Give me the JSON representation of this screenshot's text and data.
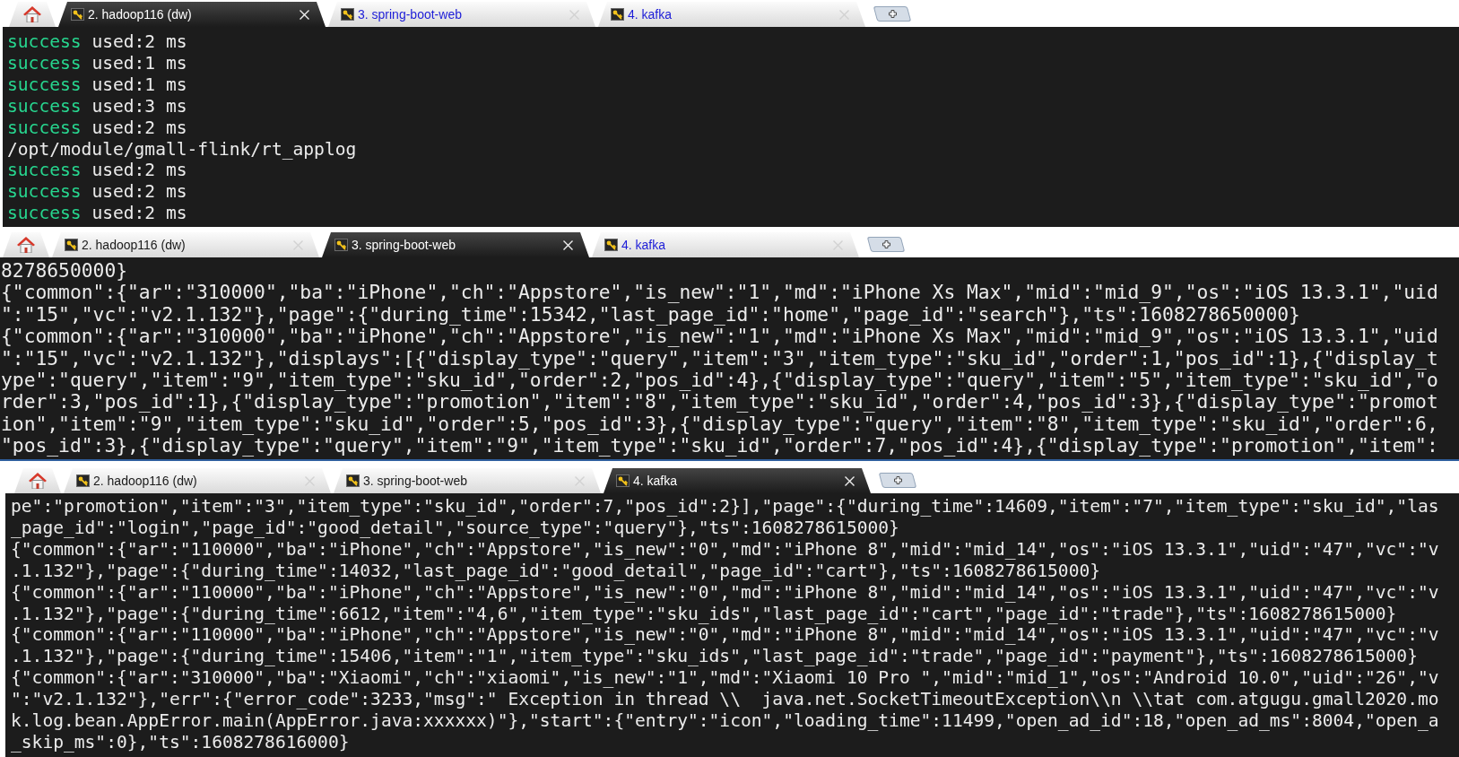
{
  "panes": [
    {
      "tabs": [
        {
          "label": "2. hadoop116 (dw)",
          "selected": true,
          "activity": false
        },
        {
          "label": "3. spring-boot-web",
          "selected": false,
          "activity": true
        },
        {
          "label": "4. kafka",
          "selected": false,
          "activity": true
        }
      ],
      "lines": [
        {
          "kind": "status",
          "status": "success",
          "text": "used:2 ms"
        },
        {
          "kind": "status",
          "status": "success",
          "text": "used:1 ms"
        },
        {
          "kind": "status",
          "status": "success",
          "text": "used:1 ms"
        },
        {
          "kind": "status",
          "status": "success",
          "text": "used:3 ms"
        },
        {
          "kind": "status",
          "status": "success",
          "text": "used:2 ms"
        },
        {
          "kind": "plain",
          "text": "/opt/module/gmall-flink/rt_applog"
        },
        {
          "kind": "status",
          "status": "success",
          "text": "used:2 ms"
        },
        {
          "kind": "status",
          "status": "success",
          "text": "used:2 ms"
        },
        {
          "kind": "status",
          "status": "success",
          "text": "used:2 ms"
        }
      ]
    },
    {
      "tabs": [
        {
          "label": "2. hadoop116 (dw)",
          "selected": false,
          "activity": false
        },
        {
          "label": "3. spring-boot-web",
          "selected": true,
          "activity": false
        },
        {
          "label": "4. kafka",
          "selected": false,
          "activity": true
        }
      ],
      "lines": [
        {
          "kind": "plain",
          "text": "8278650000}"
        },
        {
          "kind": "plain",
          "text": "{\"common\":{\"ar\":\"310000\",\"ba\":\"iPhone\",\"ch\":\"Appstore\",\"is_new\":\"1\",\"md\":\"iPhone Xs Max\",\"mid\":\"mid_9\",\"os\":\"iOS 13.3.1\",\"uid"
        },
        {
          "kind": "plain",
          "text": "\":\"15\",\"vc\":\"v2.1.132\"},\"page\":{\"during_time\":15342,\"last_page_id\":\"home\",\"page_id\":\"search\"},\"ts\":1608278650000}"
        },
        {
          "kind": "plain",
          "text": "{\"common\":{\"ar\":\"310000\",\"ba\":\"iPhone\",\"ch\":\"Appstore\",\"is_new\":\"1\",\"md\":\"iPhone Xs Max\",\"mid\":\"mid_9\",\"os\":\"iOS 13.3.1\",\"uid"
        },
        {
          "kind": "plain",
          "text": "\":\"15\",\"vc\":\"v2.1.132\"},\"displays\":[{\"display_type\":\"query\",\"item\":\"3\",\"item_type\":\"sku_id\",\"order\":1,\"pos_id\":1},{\"display_t"
        },
        {
          "kind": "plain",
          "text": "ype\":\"query\",\"item\":\"9\",\"item_type\":\"sku_id\",\"order\":2,\"pos_id\":4},{\"display_type\":\"query\",\"item\":\"5\",\"item_type\":\"sku_id\",\"o"
        },
        {
          "kind": "plain",
          "text": "rder\":3,\"pos_id\":1},{\"display_type\":\"promotion\",\"item\":\"8\",\"item_type\":\"sku_id\",\"order\":4,\"pos_id\":3},{\"display_type\":\"promot"
        },
        {
          "kind": "plain",
          "text": "ion\",\"item\":\"9\",\"item_type\":\"sku_id\",\"order\":5,\"pos_id\":3},{\"display_type\":\"query\",\"item\":\"8\",\"item_type\":\"sku_id\",\"order\":6,"
        },
        {
          "kind": "plain",
          "text": "\"pos_id\":3},{\"display_type\":\"query\",\"item\":\"9\",\"item_type\":\"sku_id\",\"order\":7,\"pos_id\":4},{\"display_type\":\"promotion\",\"item\":"
        }
      ]
    },
    {
      "tabs": [
        {
          "label": "2. hadoop116 (dw)",
          "selected": false,
          "activity": false
        },
        {
          "label": "3. spring-boot-web",
          "selected": false,
          "activity": false
        },
        {
          "label": "4. kafka",
          "selected": true,
          "activity": false
        }
      ],
      "lines": [
        {
          "kind": "plain",
          "text": "pe\":\"promotion\",\"item\":\"3\",\"item_type\":\"sku_id\",\"order\":7,\"pos_id\":2}],\"page\":{\"during_time\":14609,\"item\":\"7\",\"item_type\":\"sku_id\",\"las"
        },
        {
          "kind": "plain",
          "text": "_page_id\":\"login\",\"page_id\":\"good_detail\",\"source_type\":\"query\"},\"ts\":1608278615000}"
        },
        {
          "kind": "plain",
          "text": "{\"common\":{\"ar\":\"110000\",\"ba\":\"iPhone\",\"ch\":\"Appstore\",\"is_new\":\"0\",\"md\":\"iPhone 8\",\"mid\":\"mid_14\",\"os\":\"iOS 13.3.1\",\"uid\":\"47\",\"vc\":\"v"
        },
        {
          "kind": "plain",
          "text": ".1.132\"},\"page\":{\"during_time\":14032,\"last_page_id\":\"good_detail\",\"page_id\":\"cart\"},\"ts\":1608278615000}"
        },
        {
          "kind": "plain",
          "text": "{\"common\":{\"ar\":\"110000\",\"ba\":\"iPhone\",\"ch\":\"Appstore\",\"is_new\":\"0\",\"md\":\"iPhone 8\",\"mid\":\"mid_14\",\"os\":\"iOS 13.3.1\",\"uid\":\"47\",\"vc\":\"v"
        },
        {
          "kind": "plain",
          "text": ".1.132\"},\"page\":{\"during_time\":6612,\"item\":\"4,6\",\"item_type\":\"sku_ids\",\"last_page_id\":\"cart\",\"page_id\":\"trade\"},\"ts\":1608278615000}"
        },
        {
          "kind": "plain",
          "text": "{\"common\":{\"ar\":\"110000\",\"ba\":\"iPhone\",\"ch\":\"Appstore\",\"is_new\":\"0\",\"md\":\"iPhone 8\",\"mid\":\"mid_14\",\"os\":\"iOS 13.3.1\",\"uid\":\"47\",\"vc\":\"v"
        },
        {
          "kind": "plain",
          "text": ".1.132\"},\"page\":{\"during_time\":15406,\"item\":\"1\",\"item_type\":\"sku_ids\",\"last_page_id\":\"trade\",\"page_id\":\"payment\"},\"ts\":1608278615000}"
        },
        {
          "kind": "plain",
          "text": "{\"common\":{\"ar\":\"310000\",\"ba\":\"Xiaomi\",\"ch\":\"xiaomi\",\"is_new\":\"1\",\"md\":\"Xiaomi 10 Pro \",\"mid\":\"mid_1\",\"os\":\"Android 10.0\",\"uid\":\"26\",\"v"
        },
        {
          "kind": "plain",
          "text": "\":\"v2.1.132\"},\"err\":{\"error_code\":3233,\"msg\":\" Exception in thread \\\\  java.net.SocketTimeoutException\\\\n \\\\tat com.atgugu.gmall2020.mo"
        },
        {
          "kind": "plain",
          "text": "k.log.bean.AppError.main(AppError.java:xxxxxx)\"},\"start\":{\"entry\":\"icon\",\"loading_time\":11499,\"open_ad_id\":18,\"open_ad_ms\":8004,\"open_a"
        },
        {
          "kind": "plain",
          "text": "_skip_ms\":0},\"ts\":1608278616000}"
        }
      ]
    }
  ]
}
